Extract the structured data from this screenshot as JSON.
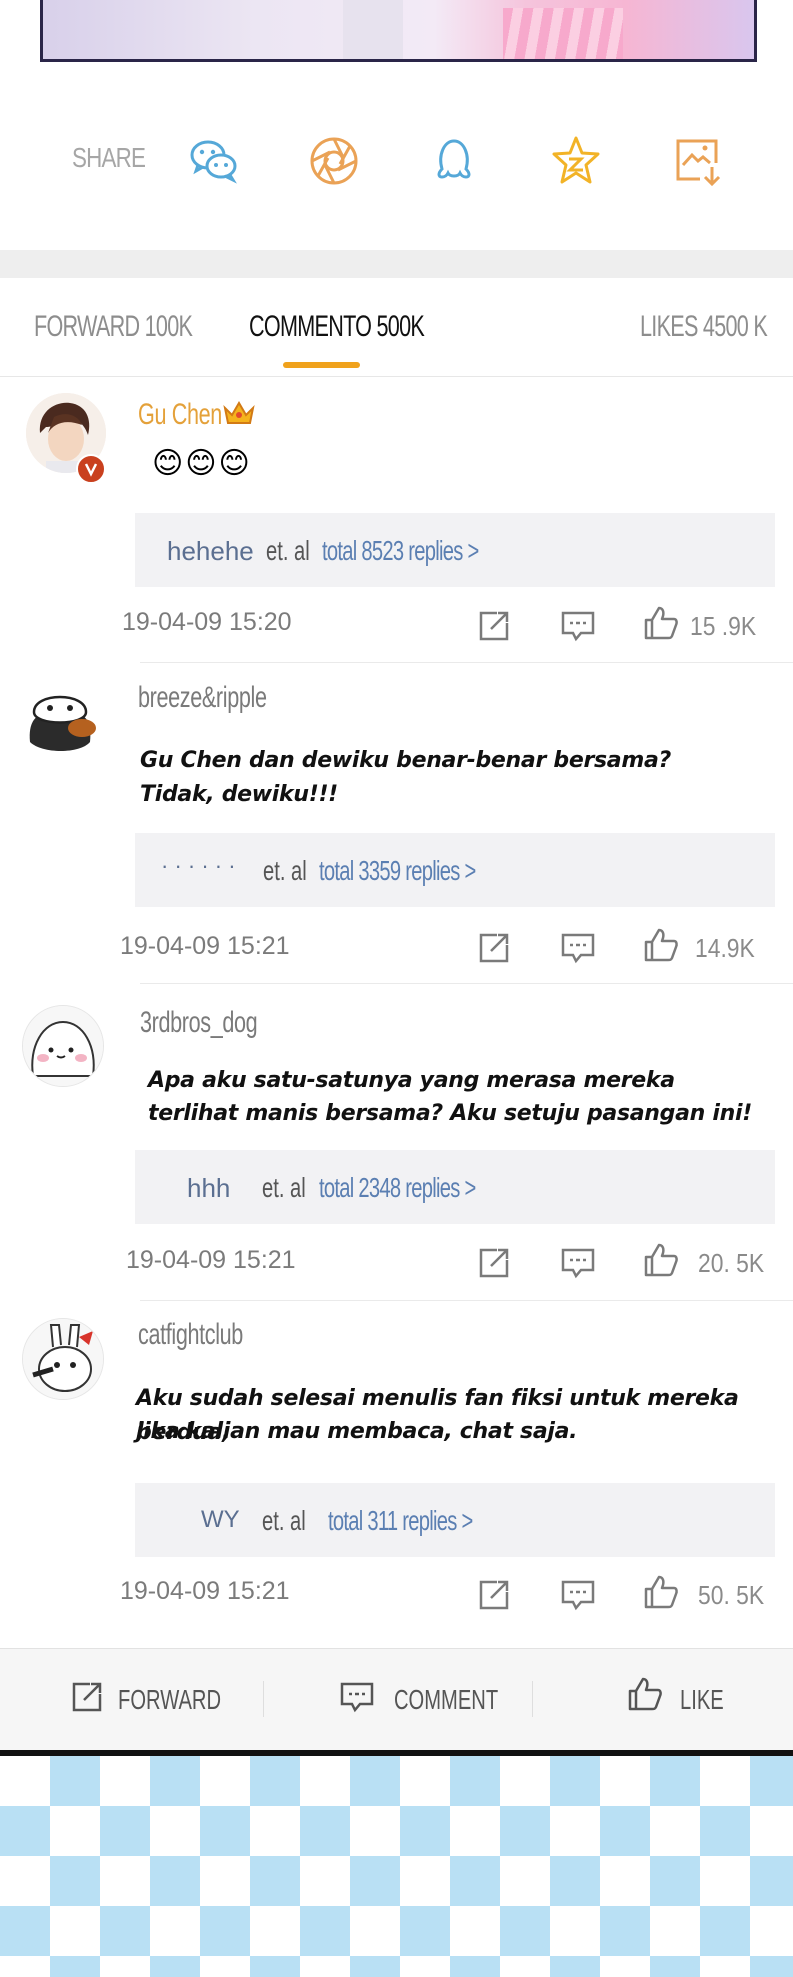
{
  "share": {
    "label": "SHARE",
    "icons": [
      "wechat-icon",
      "moments-icon",
      "qq-icon",
      "favorite-star-icon",
      "save-image-icon"
    ]
  },
  "stats": {
    "forward": "FORWARD 100K",
    "comment": "COMMENTO 500K",
    "likes": "LIKES 4500 K"
  },
  "comments": [
    {
      "username": "Gu Chen",
      "vip": true,
      "text": "",
      "emoji": "😊😊😊",
      "reply_who": "hehehe",
      "reply_etal": "et. al",
      "reply_total": "total 8523 replies >",
      "timestamp": "19-04-09 15:20",
      "likes": "15 .9K"
    },
    {
      "username": "breeze&ripple",
      "vip": false,
      "text_line1": "Gu Chen dan dewiku benar-benar bersama?",
      "text_line2": "Tidak, dewiku!!!",
      "reply_who": "· · · · · ·",
      "reply_etal": "et. al",
      "reply_total": "total 3359 replies >",
      "timestamp": "19-04-09 15:21",
      "likes": "14.9K"
    },
    {
      "username": "3rdbros_dog",
      "vip": false,
      "text_line1": "Apa aku satu-satunya yang merasa mereka",
      "text_line2": "terlihat manis bersama? Aku setuju pasangan ini!",
      "reply_who": "hhh",
      "reply_etal": "et. al",
      "reply_total": "total 2348 replies >",
      "timestamp": "19-04-09 15:21",
      "likes": "20. 5K"
    },
    {
      "username": "catfightclub",
      "vip": false,
      "text_line1": "Aku sudah selesai menulis fan fiksi untuk mereka berdua,",
      "text_line2": "jika kalian mau membaca, chat saja.",
      "reply_who": "WY",
      "reply_etal": "et. al",
      "reply_total": "total 311 replies >",
      "timestamp": "19-04-09 15:21",
      "likes": "50. 5K"
    }
  ],
  "bottom_bar": {
    "forward": "FORWARD",
    "comment": "COMMENT",
    "like": "LIKE"
  },
  "colors": {
    "accent_underline": "#f0a21c",
    "vip_name": "#e4a13a",
    "reply_link": "#5b7fb2",
    "pattern_blue": "#b9e0f4"
  }
}
